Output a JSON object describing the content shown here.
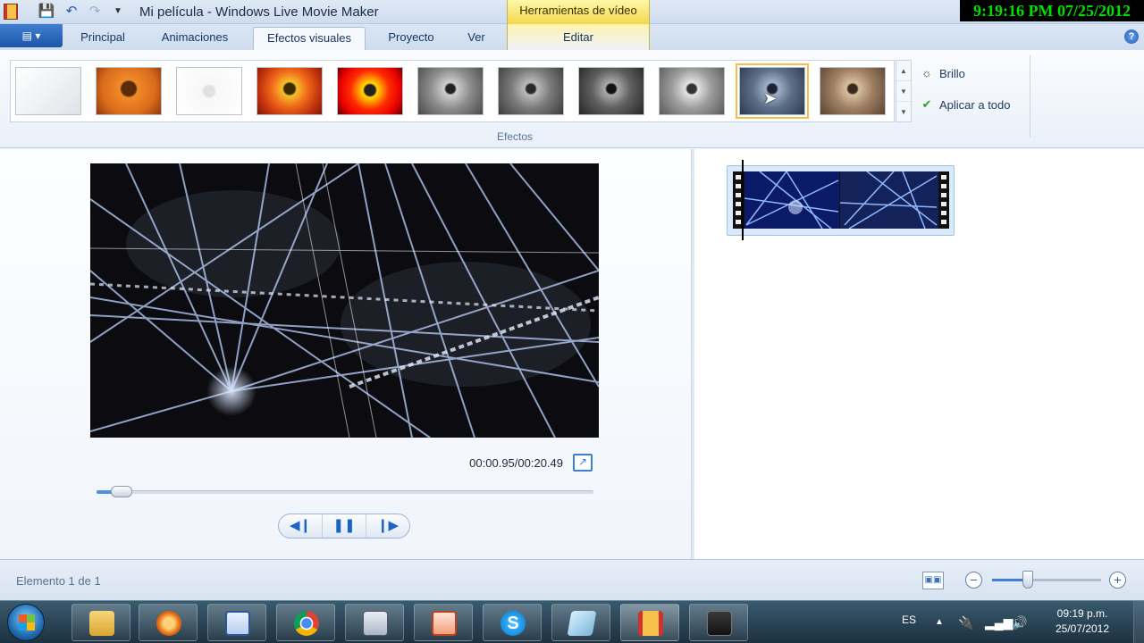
{
  "window": {
    "title": "Mi película - Windows Live Movie Maker",
    "context_tab_header": "Herramientas de vídeo",
    "clock_overlay": "9:19:16 PM 07/25/2012"
  },
  "quick_access": {
    "icons": [
      "save-icon",
      "undo-icon",
      "redo-icon",
      "customize-icon"
    ]
  },
  "ribbon": {
    "file_button_label": "▤ ▾",
    "tabs": [
      {
        "label": "Principal"
      },
      {
        "label": "Animaciones"
      },
      {
        "label": "Efectos visuales",
        "active": true
      },
      {
        "label": "Proyecto"
      },
      {
        "label": "Ver"
      },
      {
        "label": "Editar"
      }
    ],
    "effects_group_label": "Efectos",
    "brightness_label": "Brillo",
    "apply_all_label": "Aplicar a todo",
    "effects_selected_index": 9,
    "colors": {
      "selection": "#f3c14b",
      "context_tab": "#f2d84d",
      "accent": "#3d7fd2"
    }
  },
  "preview": {
    "timecode": "00:00.95/00:20.49",
    "progress_fraction": 0.046
  },
  "storyboard": {
    "clip_count": 1
  },
  "statusbar": {
    "item_text": "Elemento 1 de 1",
    "zoom_fraction": 0.33
  },
  "taskbar": {
    "apps": [
      "explorer-icon",
      "media-player-icon",
      "word-icon",
      "chrome-icon",
      "calculator-icon",
      "powerpoint-icon",
      "skype-icon",
      "notepad-icon",
      "movie-maker-icon",
      "camera-icon"
    ],
    "language": "ES",
    "time": "09:19 p.m.",
    "date": "25/07/2012"
  }
}
